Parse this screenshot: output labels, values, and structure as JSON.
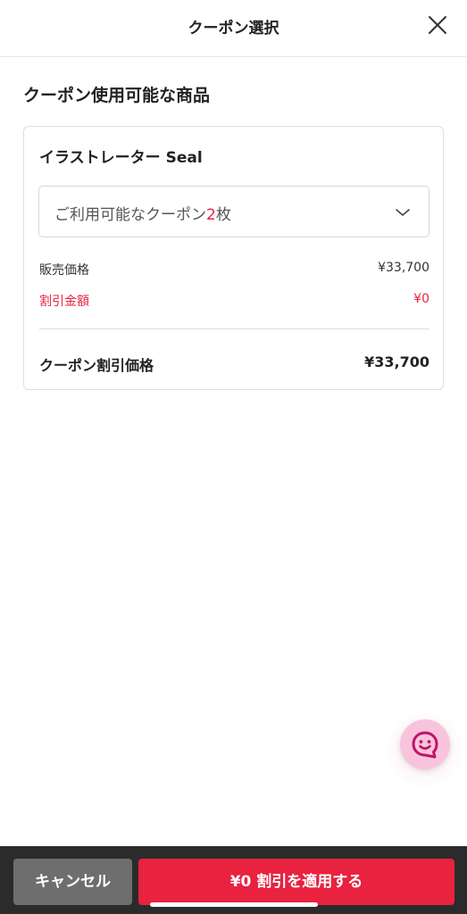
{
  "header": {
    "title": "クーポン選択",
    "close_icon": "close-icon"
  },
  "section": {
    "title": "クーポン使用可能な商品"
  },
  "product": {
    "name": "イラストレーター Seal",
    "coupon_select": {
      "prefix": "ご利用可能なクーポン",
      "count": "2",
      "suffix": "枚",
      "icon": "chevron-down-icon"
    },
    "price_label": "販売価格",
    "price_value": "¥33,700",
    "discount_label": "割引金額",
    "discount_value": "¥0",
    "total_label": "クーポン割引価格",
    "total_value": "¥33,700"
  },
  "chat": {
    "icon": "chat-icon"
  },
  "footer": {
    "cancel_label": "キャンセル",
    "apply_label": "¥0 割引を適用する"
  },
  "colors": {
    "accent": "#e8223f",
    "cancel": "#6e6e6e",
    "footer_bg": "#2b2b2b",
    "chat_bg": "#f8c4dc",
    "chat_icon": "#c0136b"
  }
}
